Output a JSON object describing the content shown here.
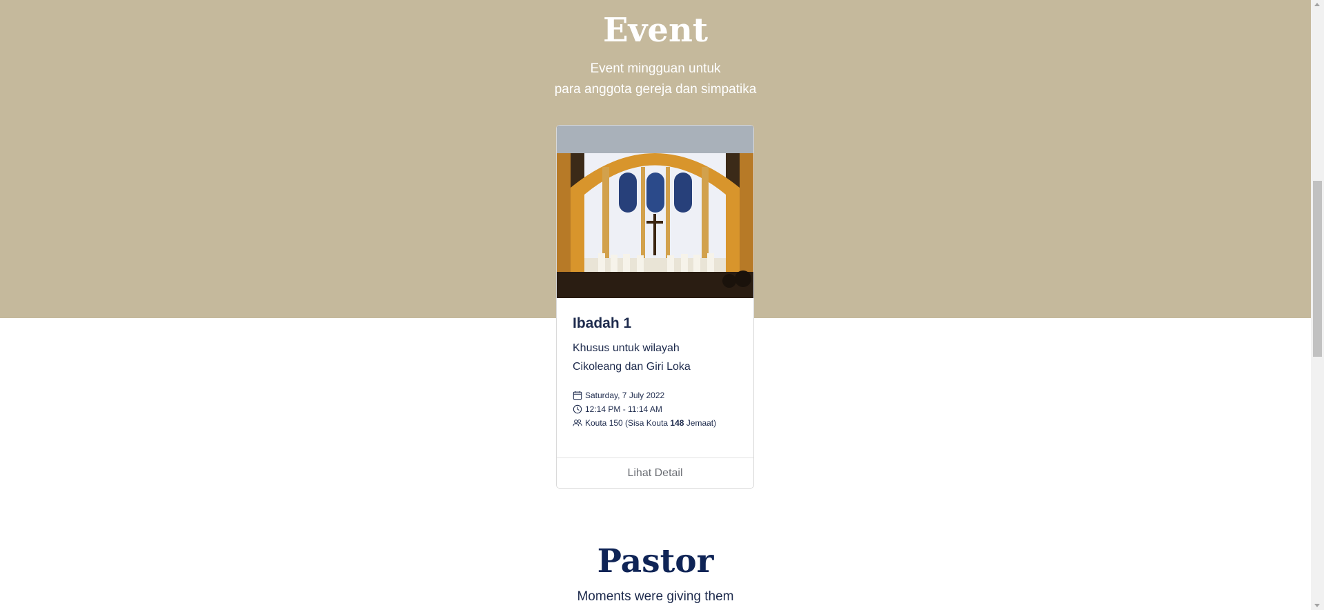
{
  "event_section": {
    "title": "Event",
    "subtitle_line1": "Event mingguan untuk",
    "subtitle_line2": "para anggota gereja dan simpatika",
    "background_color": "#c5b99c"
  },
  "event_card": {
    "image_alt": "Church altar interior with clergy",
    "title": "Ibadah 1",
    "description_line1": "Khusus untuk wilayah",
    "description_line2": "Cikoleang dan Giri Loka",
    "date": "Saturday, 7 July 2022",
    "time": "12:14 PM - 11:14 AM",
    "quota_prefix": "Kouta 150 (Sisa Kouta ",
    "quota_remaining": "148",
    "quota_suffix": " Jemaat)",
    "footer_button": "Lihat Detail",
    "icons": {
      "date": "calendar-icon",
      "time": "clock-icon",
      "quota": "users-icon"
    }
  },
  "pastor_section": {
    "title": "Pastor",
    "subtitle": "Moments were giving them"
  },
  "colors": {
    "accent_navy": "#0f2456",
    "text": "#1e2b4d"
  }
}
